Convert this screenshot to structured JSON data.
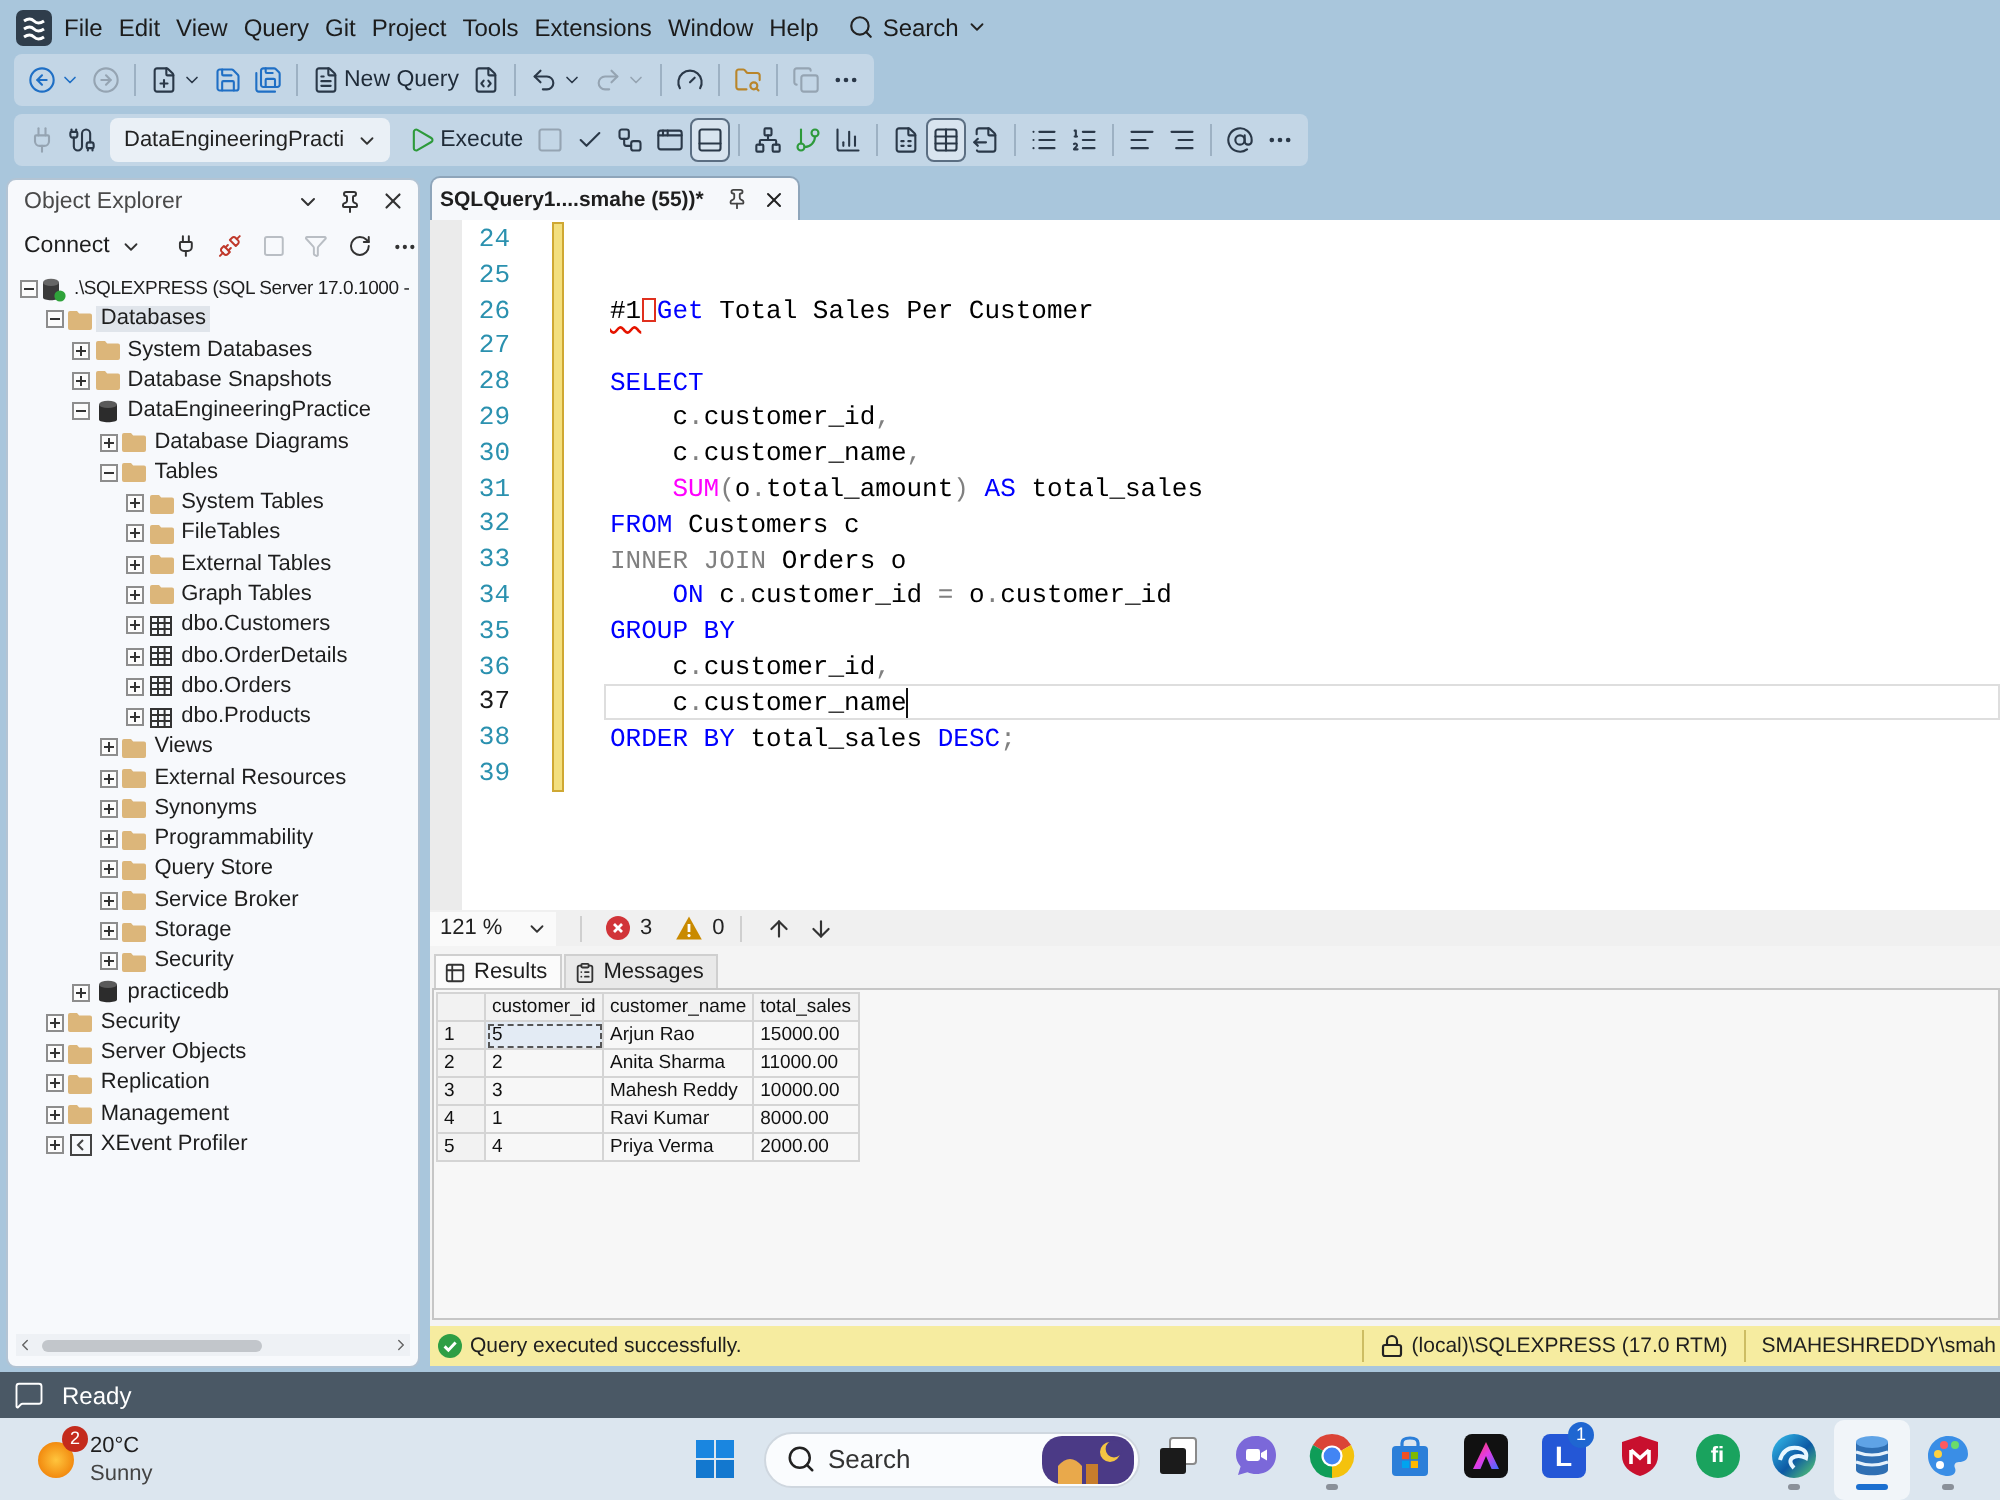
{
  "menu_bar": {
    "items": [
      "File",
      "Edit",
      "View",
      "Query",
      "Git",
      "Project",
      "Tools",
      "Extensions",
      "Window",
      "Help"
    ],
    "search_label": "Search"
  },
  "toolbars": [
    {
      "groups": [
        {
          "items": [
            {
              "disabled": false,
              "pressed": false,
              "menu": true
            },
            {
              "disabled": true,
              "pressed": false,
              "menu": false
            }
          ]
        },
        {
          "items": [
            {
              "disabled": false,
              "pressed": false,
              "menu": true
            },
            {
              "disabled": false,
              "pressed": false,
              "menu": false
            },
            {
              "disabled": false,
              "pressed": false,
              "menu": false
            }
          ]
        },
        {
          "items": [
            {
              "label": "New Query",
              "disabled": false,
              "pressed": false,
              "menu": false
            },
            {
              "disabled": false,
              "pressed": false,
              "menu": false
            }
          ]
        },
        {
          "items": [
            {
              "disabled": false,
              "pressed": false,
              "menu": true
            },
            {
              "disabled": true,
              "pressed": false,
              "menu": true
            }
          ]
        },
        {
          "items": [
            {
              "disabled": false,
              "pressed": false,
              "menu": false
            }
          ]
        },
        {
          "items": [
            {
              "disabled": false,
              "pressed": false,
              "menu": false
            }
          ]
        },
        {
          "items": [
            {
              "disabled": true,
              "pressed": false,
              "menu": false
            }
          ]
        }
      ]
    },
    {
      "database": "DataEngineeringPracti",
      "groups": [
        {
          "items": [
            {
              "disabled": true,
              "pressed": false,
              "menu": false
            },
            {
              "disabled": false,
              "pressed": false,
              "menu": false
            }
          ]
        },
        {
          "items": [
            {
              "label": "Execute",
              "disabled": false,
              "pressed": false,
              "menu": false
            },
            {
              "disabled": true,
              "pressed": false,
              "menu": false
            },
            {
              "disabled": false,
              "pressed": false,
              "menu": false
            },
            {
              "disabled": false,
              "pressed": false,
              "menu": false
            },
            {
              "disabled": false,
              "pressed": false,
              "menu": false
            },
            {
              "disabled": false,
              "pressed": true,
              "menu": false
            }
          ]
        },
        {
          "items": [
            {
              "disabled": false,
              "pressed": false,
              "menu": false
            },
            {
              "disabled": false,
              "pressed": false,
              "menu": false
            },
            {
              "disabled": false,
              "pressed": false,
              "menu": false
            }
          ]
        },
        {
          "items": [
            {
              "disabled": false,
              "pressed": false,
              "menu": false
            },
            {
              "disabled": false,
              "pressed": true,
              "menu": false
            },
            {
              "disabled": false,
              "pressed": false,
              "menu": false
            }
          ]
        },
        {
          "items": [
            {
              "disabled": false,
              "pressed": false,
              "menu": false
            },
            {
              "disabled": false,
              "pressed": false,
              "menu": false
            }
          ]
        },
        {
          "items": [
            {
              "disabled": false,
              "pressed": false,
              "menu": false
            },
            {
              "disabled": false,
              "pressed": false,
              "menu": false
            }
          ]
        },
        {
          "items": [
            {
              "disabled": false,
              "pressed": false,
              "menu": false
            }
          ]
        }
      ]
    }
  ],
  "object_explorer": {
    "title": "Object Explorer",
    "connect_label": "Connect",
    "tools": [
      {
        "disabled": false
      },
      {
        "disabled": false
      },
      {
        "disabled": true
      },
      {
        "disabled": true
      },
      {
        "disabled": false
      }
    ],
    "tree": [
      {
        "kind": "server",
        "label": ".\\SQLEXPRESS (SQL Server 17.0.1000 -",
        "expanded": true,
        "selected": false,
        "children": [
          {
            "kind": "folder",
            "label": "Databases",
            "expanded": true,
            "selected": true,
            "children": [
              {
                "kind": "folder",
                "label": "System Databases",
                "expanded": false,
                "selected": false
              },
              {
                "kind": "folder",
                "label": "Database Snapshots",
                "expanded": false,
                "selected": false
              },
              {
                "kind": "database",
                "label": "DataEngineeringPractice",
                "expanded": true,
                "selected": false,
                "children": [
                  {
                    "kind": "folder",
                    "label": "Database Diagrams",
                    "expanded": false,
                    "selected": false
                  },
                  {
                    "kind": "folder",
                    "label": "Tables",
                    "expanded": true,
                    "selected": false,
                    "children": [
                      {
                        "kind": "folder",
                        "label": "System Tables",
                        "expanded": false,
                        "selected": false
                      },
                      {
                        "kind": "folder",
                        "label": "FileTables",
                        "expanded": false,
                        "selected": false
                      },
                      {
                        "kind": "folder",
                        "label": "External Tables",
                        "expanded": false,
                        "selected": false
                      },
                      {
                        "kind": "folder",
                        "label": "Graph Tables",
                        "expanded": false,
                        "selected": false
                      },
                      {
                        "kind": "table",
                        "label": "dbo.Customers",
                        "expanded": false,
                        "selected": false
                      },
                      {
                        "kind": "table",
                        "label": "dbo.OrderDetails",
                        "expanded": false,
                        "selected": false
                      },
                      {
                        "kind": "table",
                        "label": "dbo.Orders",
                        "expanded": false,
                        "selected": false
                      },
                      {
                        "kind": "table",
                        "label": "dbo.Products",
                        "expanded": false,
                        "selected": false
                      }
                    ]
                  },
                  {
                    "kind": "folder",
                    "label": "Views",
                    "expanded": false,
                    "selected": false
                  },
                  {
                    "kind": "folder",
                    "label": "External Resources",
                    "expanded": false,
                    "selected": false
                  },
                  {
                    "kind": "folder",
                    "label": "Synonyms",
                    "expanded": false,
                    "selected": false
                  },
                  {
                    "kind": "folder",
                    "label": "Programmability",
                    "expanded": false,
                    "selected": false
                  },
                  {
                    "kind": "folder",
                    "label": "Query Store",
                    "expanded": false,
                    "selected": false
                  },
                  {
                    "kind": "folder",
                    "label": "Service Broker",
                    "expanded": false,
                    "selected": false
                  },
                  {
                    "kind": "folder",
                    "label": "Storage",
                    "expanded": false,
                    "selected": false
                  },
                  {
                    "kind": "folder",
                    "label": "Security",
                    "expanded": false,
                    "selected": false
                  }
                ]
              },
              {
                "kind": "database",
                "label": "practicedb",
                "expanded": false,
                "selected": false
              }
            ]
          },
          {
            "kind": "folder",
            "label": "Security",
            "expanded": false,
            "selected": false
          },
          {
            "kind": "folder",
            "label": "Server Objects",
            "expanded": false,
            "selected": false
          },
          {
            "kind": "folder",
            "label": "Replication",
            "expanded": false,
            "selected": false
          },
          {
            "kind": "folder",
            "label": "Management",
            "expanded": false,
            "selected": false
          },
          {
            "kind": "profiler",
            "label": "XEvent Profiler",
            "expanded": false,
            "selected": false
          }
        ]
      }
    ]
  },
  "editor": {
    "tab_title": "SQLQuery1....smahe (55))*",
    "modified": true,
    "zoom": "121 %",
    "errors": "3",
    "warnings": "0",
    "lines": [
      {
        "number": "24",
        "current": false
      },
      {
        "number": "25",
        "current": false
      },
      {
        "number": "26",
        "current": false,
        "indented": false,
        "tokens": [
          {
            "kind": "error",
            "text": "#1"
          },
          {
            "kind": "marker"
          },
          {
            "kind": "keyword",
            "text": "Get"
          },
          {
            "kind": "plain",
            "text": " Total Sales Per Customer"
          }
        ]
      },
      {
        "number": "27",
        "current": false
      },
      {
        "number": "28",
        "current": false,
        "indented": false,
        "tokens": [
          {
            "kind": "keyword",
            "text": "SELECT"
          }
        ]
      },
      {
        "number": "29",
        "current": false,
        "indented": true,
        "tokens": [
          {
            "kind": "plain",
            "text": "c"
          },
          {
            "kind": "operator",
            "text": "."
          },
          {
            "kind": "plain",
            "text": "customer_id"
          },
          {
            "kind": "operator",
            "text": ","
          }
        ]
      },
      {
        "number": "30",
        "current": false,
        "indented": true,
        "tokens": [
          {
            "kind": "plain",
            "text": "c"
          },
          {
            "kind": "operator",
            "text": "."
          },
          {
            "kind": "plain",
            "text": "customer_name"
          },
          {
            "kind": "operator",
            "text": ","
          }
        ]
      },
      {
        "number": "31",
        "current": false,
        "indented": true,
        "tokens": [
          {
            "kind": "function",
            "text": "SUM"
          },
          {
            "kind": "operator",
            "text": "("
          },
          {
            "kind": "plain",
            "text": "o"
          },
          {
            "kind": "operator",
            "text": "."
          },
          {
            "kind": "plain",
            "text": "total_amount"
          },
          {
            "kind": "operator",
            "text": ")"
          },
          {
            "kind": "keyword",
            "text": " AS"
          },
          {
            "kind": "plain",
            "text": " total_sales"
          }
        ]
      },
      {
        "number": "32",
        "current": false,
        "indented": false,
        "tokens": [
          {
            "kind": "keyword",
            "text": "FROM"
          },
          {
            "kind": "plain",
            "text": " Customers c"
          }
        ]
      },
      {
        "number": "33",
        "current": false,
        "indented": false,
        "tokens": [
          {
            "kind": "operator",
            "text": "INNER JOIN"
          },
          {
            "kind": "plain",
            "text": " Orders o"
          }
        ]
      },
      {
        "number": "34",
        "current": false,
        "indented": true,
        "tokens": [
          {
            "kind": "keyword",
            "text": "ON"
          },
          {
            "kind": "plain",
            "text": " c"
          },
          {
            "kind": "operator",
            "text": "."
          },
          {
            "kind": "plain",
            "text": "customer_id "
          },
          {
            "kind": "operator",
            "text": "="
          },
          {
            "kind": "plain",
            "text": " o"
          },
          {
            "kind": "operator",
            "text": "."
          },
          {
            "kind": "plain",
            "text": "customer_id"
          }
        ]
      },
      {
        "number": "35",
        "current": false,
        "indented": false,
        "tokens": [
          {
            "kind": "keyword",
            "text": "GROUP BY"
          }
        ]
      },
      {
        "number": "36",
        "current": false,
        "indented": true,
        "tokens": [
          {
            "kind": "plain",
            "text": "c"
          },
          {
            "kind": "operator",
            "text": "."
          },
          {
            "kind": "plain",
            "text": "customer_id"
          },
          {
            "kind": "operator",
            "text": ","
          }
        ]
      },
      {
        "number": "37",
        "current": true,
        "indented": true,
        "tokens": [
          {
            "kind": "plain",
            "text": "c"
          },
          {
            "kind": "operator",
            "text": "."
          },
          {
            "kind": "plain",
            "text": "customer_name"
          }
        ]
      },
      {
        "number": "38",
        "current": false,
        "indented": false,
        "tokens": [
          {
            "kind": "keyword",
            "text": "ORDER BY"
          },
          {
            "kind": "plain",
            "text": " total_sales "
          },
          {
            "kind": "keyword",
            "text": "DESC"
          },
          {
            "kind": "operator",
            "text": ";"
          }
        ]
      },
      {
        "number": "39",
        "current": false
      }
    ]
  },
  "results": {
    "tabs": [
      {
        "label": "Results",
        "selected": true
      },
      {
        "label": "Messages",
        "selected": false
      }
    ],
    "columns": [
      "customer_id",
      "customer_name",
      "total_sales"
    ],
    "rows": [
      {
        "number": "1",
        "cells": [
          {
            "text": "5",
            "selected": true
          },
          {
            "text": "Arjun Rao",
            "selected": false
          },
          {
            "text": "15000.00",
            "selected": false
          }
        ]
      },
      {
        "number": "2",
        "cells": [
          {
            "text": "2",
            "selected": false
          },
          {
            "text": "Anita Sharma",
            "selected": false
          },
          {
            "text": "11000.00",
            "selected": false
          }
        ]
      },
      {
        "number": "3",
        "cells": [
          {
            "text": "3",
            "selected": false
          },
          {
            "text": "Mahesh Reddy",
            "selected": false
          },
          {
            "text": "10000.00",
            "selected": false
          }
        ]
      },
      {
        "number": "4",
        "cells": [
          {
            "text": "1",
            "selected": false
          },
          {
            "text": "Ravi Kumar",
            "selected": false
          },
          {
            "text": "8000.00",
            "selected": false
          }
        ]
      },
      {
        "number": "5",
        "cells": [
          {
            "text": "4",
            "selected": false
          },
          {
            "text": "Priya Verma",
            "selected": false
          },
          {
            "text": "2000.00",
            "selected": false
          }
        ]
      }
    ]
  },
  "query_status": {
    "message": "Query executed successfully.",
    "server": "(local)\\SQLEXPRESS (17.0 RTM)",
    "user": "SMAHESHREDDY\\smah"
  },
  "app_status": "Ready",
  "taskbar": {
    "weather": {
      "temperature": "20°C",
      "condition": "Sunny",
      "badge": "2"
    },
    "search": {
      "placeholder": "Search"
    },
    "apps": [
      {
        "running": false,
        "selected": false
      },
      {
        "running": false,
        "selected": false
      },
      {
        "running": true,
        "selected": false
      },
      {
        "running": false,
        "selected": false
      },
      {
        "running": false,
        "selected": false
      },
      {
        "running": false,
        "selected": false,
        "glyph": "L",
        "badge": "1"
      },
      {
        "running": false,
        "selected": false
      },
      {
        "running": false,
        "selected": false,
        "glyph": "fi"
      },
      {
        "running": true,
        "selected": false
      },
      {
        "running": true,
        "selected": true
      },
      {
        "running": true,
        "selected": false
      }
    ]
  }
}
